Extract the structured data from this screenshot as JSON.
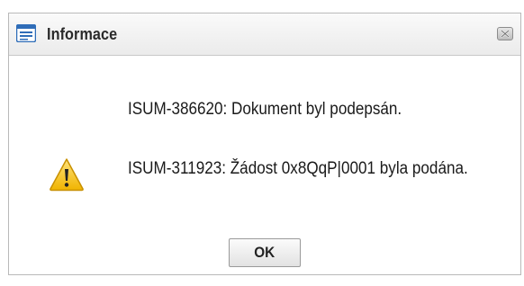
{
  "dialog": {
    "title": "Informace",
    "title_icon": "window-icon",
    "close_icon": "close-icon",
    "status_icon": "warning-icon",
    "messages": [
      "ISUM-386620: Dokument byl podepsán.",
      "ISUM-311923: Žádost 0x8QqP|0001 byla podána."
    ],
    "ok_label": "OK"
  },
  "colors": {
    "title_icon_blue": "#2f6db8",
    "warning_yellow": "#f2c230",
    "warning_outline": "#c89000"
  }
}
